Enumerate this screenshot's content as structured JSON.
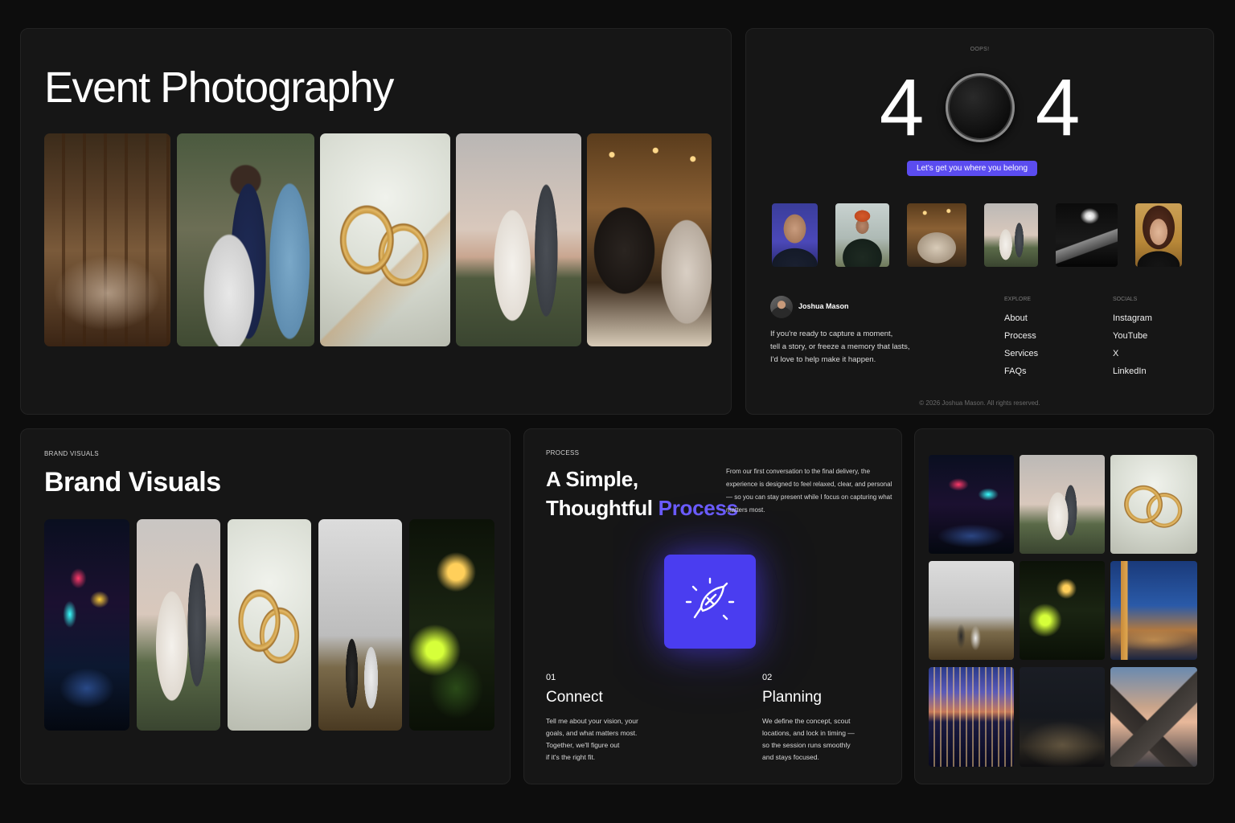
{
  "event": {
    "title": "Event Photography",
    "photos": [
      "banquet-table-photo",
      "wedding-kiss-photo",
      "wedding-rings-photo",
      "couple-field-photo",
      "reception-dinner-photo"
    ]
  },
  "not_found": {
    "eyebrow": "OOPS!",
    "digit_left": "4",
    "digit_right": "4",
    "cta": "Let's get you where you belong",
    "thumbs": [
      "portrait-woman-blue-photo",
      "portrait-man-beanie-photo",
      "reception-photo",
      "couple-photo",
      "night-road-photo",
      "portrait-woman-curly-photo"
    ],
    "author": {
      "name": "Joshua Mason",
      "bio_line1": "If you're ready to capture a moment,",
      "bio_line2": "tell a story, or freeze a memory that lasts,",
      "bio_line3": "I'd love to help make it happen."
    },
    "explore": {
      "heading": "EXPLORE",
      "links": [
        "About",
        "Process",
        "Services",
        "FAQs"
      ]
    },
    "socials": {
      "heading": "SOCIALS",
      "links": [
        "Instagram",
        "YouTube",
        "X",
        "LinkedIn"
      ]
    },
    "copyright": "© 2026 Joshua Mason. All rights reserved."
  },
  "brand": {
    "eyebrow": "BRAND VISUALS",
    "title": "Brand Visuals"
  },
  "process": {
    "eyebrow": "PROCESS",
    "title_line1": "A Simple,",
    "title_line2_plain": "Thoughtful",
    "title_line2_accent": "Process",
    "description": "From our first conversation to the final delivery, the experience is designed to feel relaxed, clear, and personal — so you can stay present while I focus on capturing what matters most.",
    "icon": "quill-sparkle-icon",
    "steps": [
      {
        "num": "01",
        "title": "Connect",
        "l1": "Tell me about your vision, your",
        "l2": "goals, and what matters most.",
        "l3": "Together, we'll figure out",
        "l4": "if it's the right fit."
      },
      {
        "num": "02",
        "title": "Planning",
        "l1": "We define the concept, scout",
        "l2": "locations, and lock in timing —",
        "l3": "so the session runs smoothly",
        "l4": "and stays focused."
      }
    ]
  },
  "colors": {
    "background": "#0d0d0d",
    "card": "#161616",
    "accent": "#5b4cf0",
    "accent_text": "#6b5cff"
  }
}
